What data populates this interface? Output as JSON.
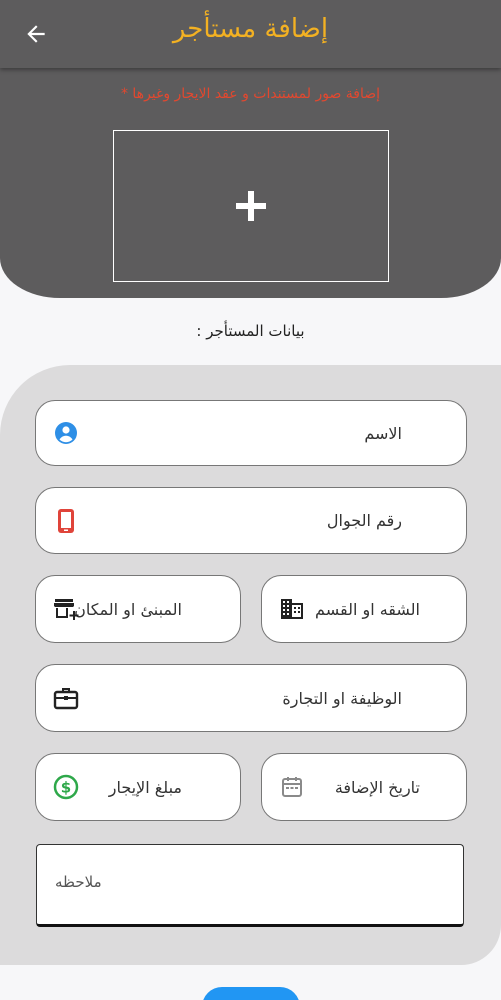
{
  "appbar": {
    "title": "إضافة مستأجر",
    "back_icon": "arrow-left-icon"
  },
  "upload": {
    "hint": "إضافة صور لمستندات و عقد الايجار وغيرها *",
    "add_icon": "plus-icon"
  },
  "section": {
    "title": "بيانات المستأجر :"
  },
  "fields": {
    "name": {
      "placeholder": "الاسم",
      "icon": "person-icon",
      "icon_color": "#2e8fe6"
    },
    "phone": {
      "placeholder": "رقم الجوال",
      "icon": "phone-icon",
      "icon_color": "#e0443a"
    },
    "apartment": {
      "placeholder": "الشقه او القسم",
      "icon": "building-icon",
      "icon_color": "#222222"
    },
    "building": {
      "placeholder": "المبنئ او المكان",
      "icon": "add-business-icon",
      "icon_color": "#222222"
    },
    "job": {
      "placeholder": "الوظيفة او التجارة",
      "icon": "briefcase-icon",
      "icon_color": "#222222"
    },
    "date": {
      "placeholder": "تاريخ الإضافة",
      "icon": "calendar-icon",
      "icon_color": "#8a8a8a"
    },
    "rent": {
      "placeholder": "مبلغ الإيجار",
      "icon": "dollar-icon",
      "icon_color": "#2ea84a"
    },
    "notes": {
      "placeholder": "ملاحظه"
    }
  },
  "colors": {
    "header": "#5d5c5d",
    "accent": "#f3b122",
    "hint": "#e2482f",
    "fab": "#2196f3"
  }
}
